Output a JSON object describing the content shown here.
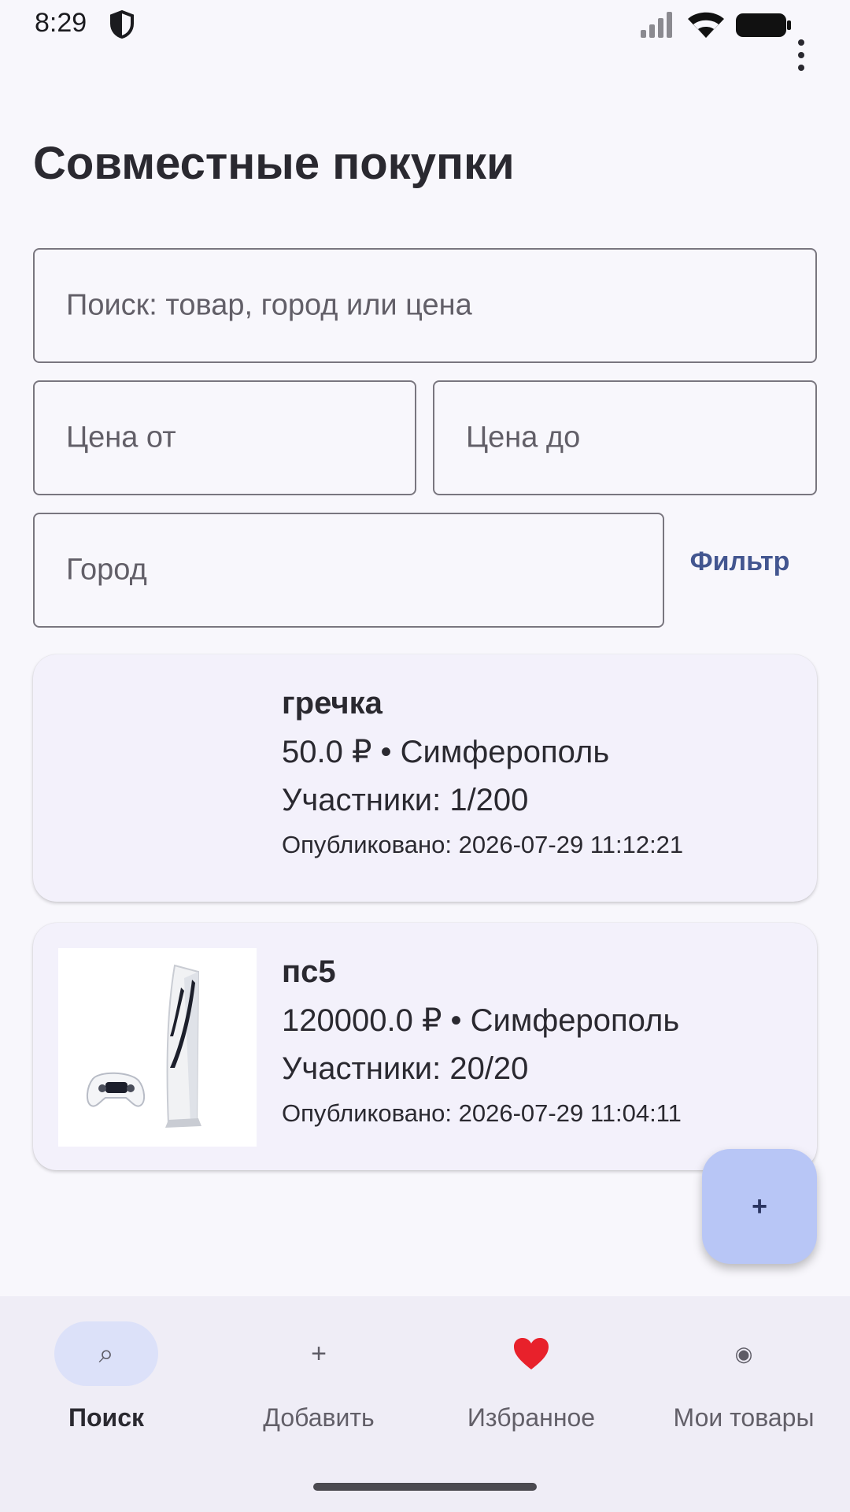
{
  "status_bar": {
    "time": "8:29"
  },
  "header": {
    "title": "Совместные покупки"
  },
  "filters": {
    "search_placeholder": "Поиск: товар, город или цена",
    "price_from_placeholder": "Цена от",
    "price_to_placeholder": "Цена до",
    "city_placeholder": "Город",
    "filter_button": "Фильтр"
  },
  "listings": [
    {
      "title": "гречка",
      "price_city": "50.0 ₽ • Симферополь",
      "members": "Участники: 1/200",
      "published": "Опубликовано: 2026-07-29 11:12:21"
    },
    {
      "title": "пс5",
      "price_city": "120000.0 ₽ • Симферополь",
      "members": "Участники: 20/20",
      "published": "Опубликовано: 2026-07-29 11:04:11"
    }
  ],
  "fab": {
    "label": "+"
  },
  "bottom_nav": [
    {
      "label": "Поиск",
      "icon": "⌕",
      "icon_name": "search-icon",
      "active": true
    },
    {
      "label": "Добавить",
      "icon": "+",
      "icon_name": "plus-icon",
      "active": false
    },
    {
      "label": "Избранное",
      "icon": "heart",
      "icon_name": "heart-icon",
      "active": false
    },
    {
      "label": "Мои товары",
      "icon": "◉",
      "icon_name": "radio-dot-icon",
      "active": false
    }
  ],
  "colors": {
    "accent": "#435690",
    "fab": "#b8c6f6",
    "heart": "#e8212b",
    "background": "#f8f7fc"
  }
}
